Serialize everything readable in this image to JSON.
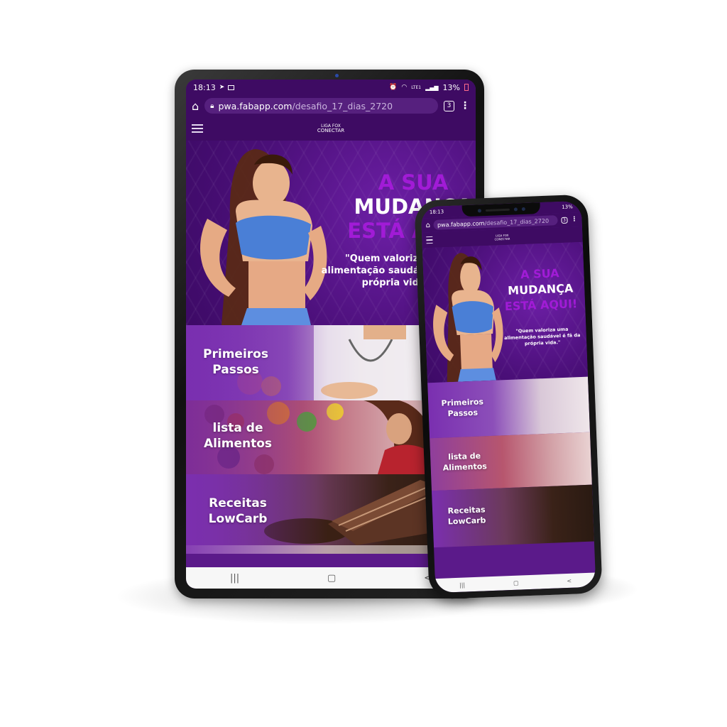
{
  "status": {
    "time": "18:13",
    "telegram_icon": "telegram-icon",
    "image_icon": "image-icon",
    "network_label": "LTE1",
    "battery": "13%"
  },
  "browser": {
    "home_icon": "home-icon",
    "lock_icon": "lock-icon",
    "url_host": "pwa.fabapp.com",
    "url_path": "/desafio_17_dias_2720",
    "phone_url_path": "/desafio_17_dias_2720",
    "tab_count": "3",
    "menu_glyph": "⋮"
  },
  "app": {
    "logo_line1": "LIGA FOX",
    "logo_line2": "CONECTAR"
  },
  "hero": {
    "headline_1": "A SUA",
    "headline_2": "MUDANÇA",
    "headline_3": "ESTÁ AQUI!",
    "quote_line1": "\"Quem valoriza uma",
    "quote_line2": "alimentação saudável é fã da",
    "quote_line3": "própria vida.\""
  },
  "banners": [
    {
      "label_line1": "Primeiros",
      "label_line2": "Passos"
    },
    {
      "label_line1": "lista de",
      "label_line2": "Alimentos"
    },
    {
      "label_line1": "Receitas",
      "label_line2": "LowCarb"
    }
  ],
  "navbar": {
    "recents_glyph": "|||",
    "home_glyph": "▢",
    "back_glyph": "<"
  },
  "colors": {
    "brand_purple": "#5b1a8a",
    "dark_purple": "#3e0b63",
    "headline_accent": "#a11bd6"
  }
}
